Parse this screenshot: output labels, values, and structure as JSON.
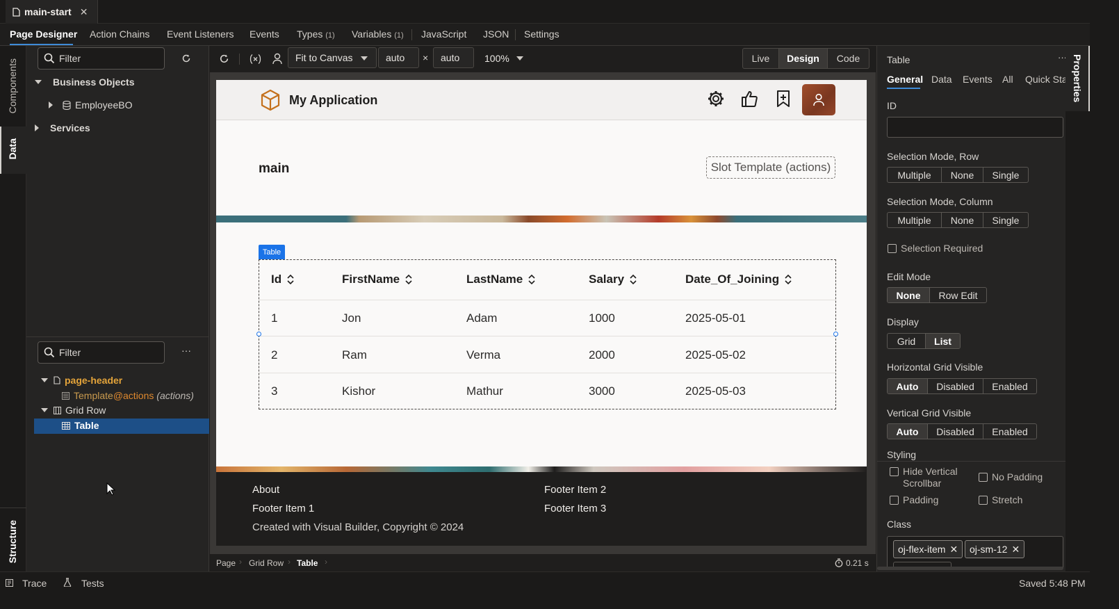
{
  "file_tab": {
    "name": "main-start",
    "close": "✕"
  },
  "designer_tabs": [
    {
      "label": "Page Designer",
      "count": ""
    },
    {
      "label": "Action Chains",
      "count": ""
    },
    {
      "label": "Event Listeners",
      "count": ""
    },
    {
      "label": "Events",
      "count": ""
    },
    {
      "label": "Types",
      "count": "(1)"
    },
    {
      "label": "Variables",
      "count": "(1)"
    },
    {
      "label": "JavaScript",
      "count": ""
    },
    {
      "label": "JSON",
      "count": ""
    },
    {
      "label": "Settings",
      "count": ""
    }
  ],
  "left_rail": {
    "components": "Components",
    "data": "Data",
    "structure": "Structure"
  },
  "data_panel": {
    "filter_placeholder": "Filter",
    "business_objects": "Business Objects",
    "employee_bo": "EmployeeBO",
    "services": "Services"
  },
  "structure_panel": {
    "filter_placeholder": "Filter",
    "more": "···",
    "page_header": "page-header",
    "template_name": "Template",
    "template_slot": "@actions",
    "template_hint": "(actions)",
    "grid_row": "Grid Row",
    "table": "Table"
  },
  "canvas_toolbar": {
    "fit": "Fit to Canvas",
    "width": "auto",
    "times": "×",
    "height": "auto",
    "zoom": "100%",
    "modes": [
      "Live",
      "Design",
      "Code"
    ],
    "active_mode": "Design"
  },
  "app": {
    "title": "My Application",
    "main_title": "main",
    "slot_template": "Slot Template (actions)",
    "table_badge": "Table",
    "columns": [
      "Id",
      "FirstName",
      "LastName",
      "Salary",
      "Date_Of_Joining"
    ],
    "rows": [
      [
        "1",
        "Jon",
        "Adam",
        "1000",
        "2025-05-01"
      ],
      [
        "2",
        "Ram",
        "Verma",
        "2000",
        "2025-05-02"
      ],
      [
        "3",
        "Kishor",
        "Mathur",
        "3000",
        "2025-05-03"
      ]
    ],
    "footer": {
      "about": "About",
      "item1": "Footer Item 1",
      "item2": "Footer Item 2",
      "item3": "Footer Item 3",
      "copyright": "Created with Visual Builder, Copyright © 2024"
    }
  },
  "breadcrumb": [
    "Page",
    "Grid Row",
    "Table"
  ],
  "timer": "0.21 s",
  "properties": {
    "title": "Table",
    "more": "···",
    "tabs": [
      "General",
      "Data",
      "Events",
      "All",
      "Quick Sta"
    ],
    "rail_label": "Properties",
    "id_label": "ID",
    "id_value": "",
    "selection_row_label": "Selection Mode, Row",
    "selection_row_options": [
      "Multiple",
      "None",
      "Single"
    ],
    "selection_col_label": "Selection Mode, Column",
    "selection_col_options": [
      "Multiple",
      "None",
      "Single"
    ],
    "selection_required": "Selection Required",
    "edit_mode_label": "Edit Mode",
    "edit_mode_options": [
      "None",
      "Row Edit"
    ],
    "edit_mode_selected": "None",
    "display_label": "Display",
    "display_options": [
      "Grid",
      "List"
    ],
    "display_selected": "List",
    "hgrid_label": "Horizontal Grid Visible",
    "hgrid_options": [
      "Auto",
      "Disabled",
      "Enabled"
    ],
    "vgrid_label": "Vertical Grid Visible",
    "vgrid_options": [
      "Auto",
      "Disabled",
      "Enabled"
    ],
    "styling_label": "Styling",
    "styling_hide_vscroll_1": "Hide Vertical",
    "styling_hide_vscroll_2": "Scrollbar",
    "styling_no_padding": "No Padding",
    "styling_padding": "Padding",
    "styling_stretch": "Stretch",
    "class_label": "Class",
    "class_chips": [
      "oj-flex-item",
      "oj-sm-12"
    ]
  },
  "statusbar": {
    "trace": "Trace",
    "tests": "Tests",
    "saved": "Saved 5:48 PM"
  }
}
